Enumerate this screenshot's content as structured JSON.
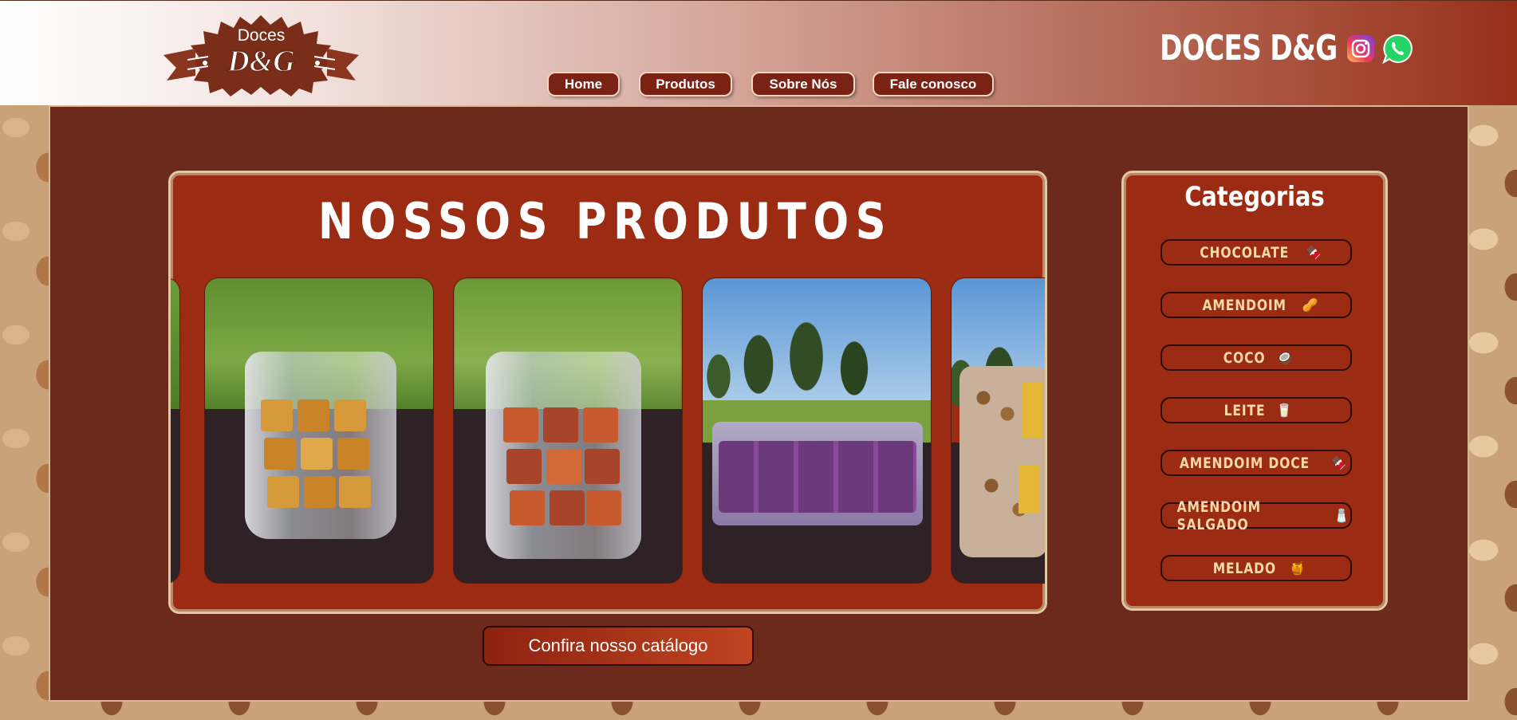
{
  "header": {
    "logo": {
      "top": "Doces",
      "main": "D&G"
    },
    "nav": [
      {
        "label": "Home"
      },
      {
        "label": "Produtos"
      },
      {
        "label": "Sobre Nós"
      },
      {
        "label": "Fale conosco"
      }
    ],
    "brand": "DOCES D&G",
    "social": [
      {
        "icon": "instagram-icon"
      },
      {
        "icon": "whatsapp-icon"
      }
    ]
  },
  "products": {
    "title": "NOSSOS PRODUTOS",
    "catalog_button": "Confira nosso catálogo"
  },
  "categories": {
    "title": "Categorias",
    "items": [
      {
        "label": "CHOCOLATE",
        "emoji": "🍫"
      },
      {
        "label": "AMENDOIM",
        "emoji": "🥜"
      },
      {
        "label": "COCO",
        "emoji": "🥥"
      },
      {
        "label": "LEITE",
        "emoji": "🥛"
      },
      {
        "label": "AMENDOIM DOCE",
        "emoji": "🍫"
      },
      {
        "label": "AMENDOIM SALGADO",
        "emoji": "🧂"
      },
      {
        "label": "MELADO",
        "emoji": "🍯"
      }
    ]
  },
  "colors": {
    "accent": "#9c2b14",
    "panel": "#6c2a1c",
    "nav_button": "#7a2214",
    "category_text": "#f7d8a8"
  }
}
